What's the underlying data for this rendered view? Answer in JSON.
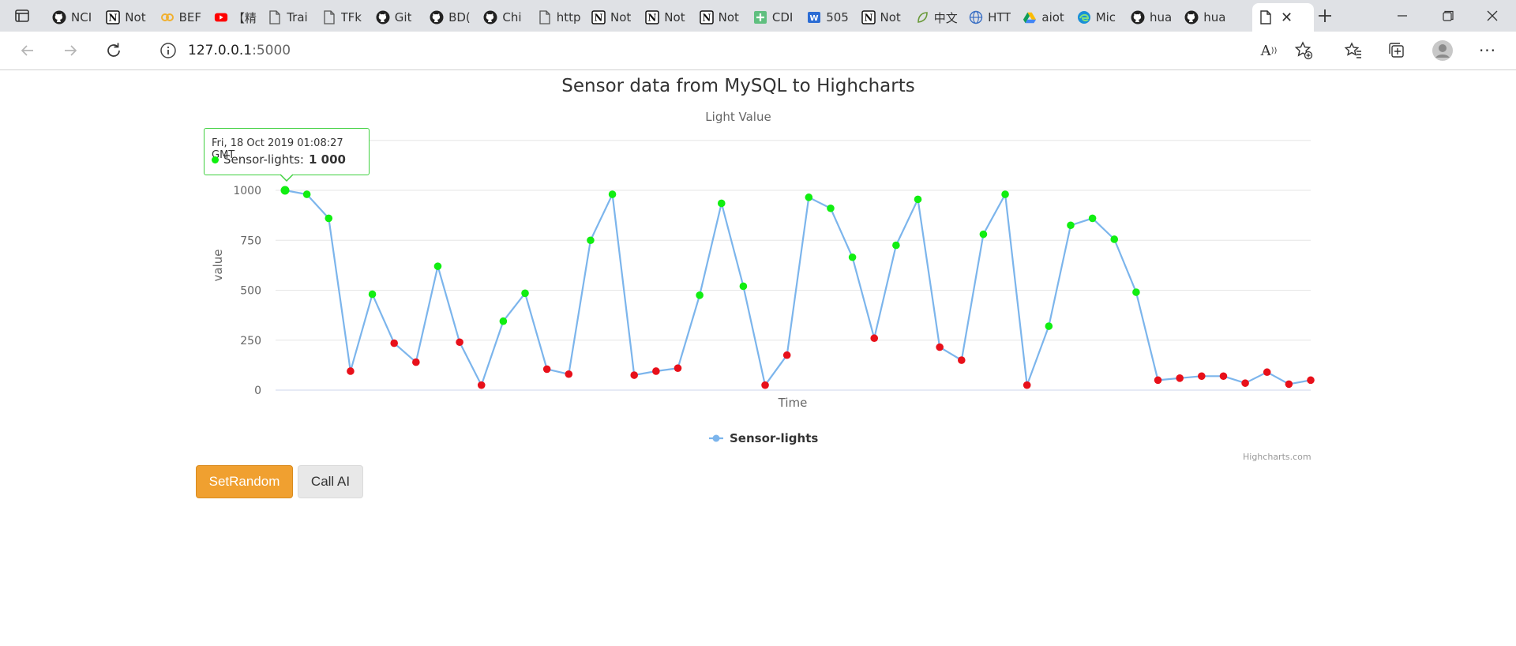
{
  "browser": {
    "tabs": [
      {
        "label": "NCI",
        "icon": "github-icon"
      },
      {
        "label": "Not",
        "icon": "notion-icon"
      },
      {
        "label": "BEF",
        "icon": "link-icon"
      },
      {
        "label": "【精",
        "icon": "youtube-icon"
      },
      {
        "label": "Trai",
        "icon": "page-icon"
      },
      {
        "label": "TFk",
        "icon": "page-icon"
      },
      {
        "label": "Git",
        "icon": "github-icon"
      },
      {
        "label": "BD(",
        "icon": "github-icon"
      },
      {
        "label": "Chi",
        "icon": "github-icon"
      },
      {
        "label": "http",
        "icon": "page-icon"
      },
      {
        "label": "Not",
        "icon": "notion-icon"
      },
      {
        "label": "Not",
        "icon": "notion-icon"
      },
      {
        "label": "Not",
        "icon": "notion-icon"
      },
      {
        "label": "CDI",
        "icon": "plus-sheet-icon"
      },
      {
        "label": "505",
        "icon": "word-icon"
      },
      {
        "label": "Not",
        "icon": "notion-icon"
      },
      {
        "label": "中文",
        "icon": "leaf-icon"
      },
      {
        "label": "HTT",
        "icon": "globe-icon"
      },
      {
        "label": "aiot",
        "icon": "drive-icon"
      },
      {
        "label": "Mic",
        "icon": "edge-icon"
      },
      {
        "label": "hua",
        "icon": "github-icon"
      },
      {
        "label": "hua",
        "icon": "github-icon"
      }
    ],
    "url_host": "127.0.0.1",
    "url_port": ":5000"
  },
  "chart_data": {
    "type": "line",
    "title": "Sensor data from MySQL to Highcharts",
    "subtitle": "Light Value",
    "xlabel": "Time",
    "ylabel": "value",
    "ylim": [
      0,
      1250
    ],
    "yticks": [
      "0",
      "250",
      "500",
      "750",
      "1000"
    ],
    "legend": "bottom-center",
    "grid": true,
    "threshold": 300,
    "colors": {
      "line": "#7cb5ec",
      "above": "#11ee11",
      "below": "#e8101a"
    },
    "series": [
      {
        "name": "Sensor-lights",
        "values": [
          1000,
          980,
          860,
          95,
          480,
          235,
          140,
          620,
          240,
          25,
          345,
          485,
          105,
          80,
          750,
          980,
          75,
          95,
          110,
          475,
          935,
          520,
          25,
          175,
          965,
          910,
          665,
          260,
          725,
          955,
          215,
          150,
          780,
          980,
          25,
          320,
          825,
          860,
          755,
          490,
          50,
          60,
          70,
          70,
          35,
          90,
          30,
          50
        ]
      }
    ],
    "tooltip": {
      "time": "Fri, 18 Oct 2019 01:08:27 GMT",
      "series": "Sensor-lights:",
      "value": "1 000"
    },
    "credits": "Highcharts.com"
  },
  "buttons": {
    "random": "SetRandom",
    "ai": "Call AI"
  }
}
